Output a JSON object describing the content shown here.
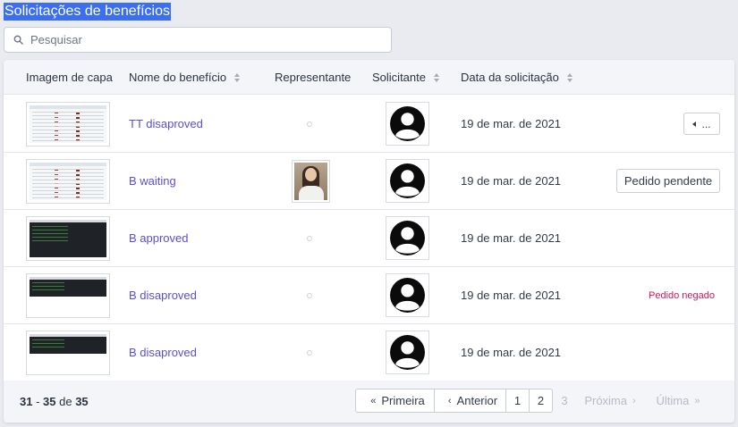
{
  "page_title": "Solicitações de benefícios",
  "search": {
    "placeholder": "Pesquisar",
    "value": ""
  },
  "table": {
    "headers": {
      "cover": "Imagem de capa",
      "benefit": "Nome do benefício",
      "representative": "Representante",
      "requester": "Solicitante",
      "date": "Data da solicitação"
    },
    "rows": [
      {
        "cover_style": "light",
        "benefit": "TT disaproved",
        "has_representative": false,
        "date": "19 de mar. de 2021",
        "action": "more-button",
        "action_label": "..."
      },
      {
        "cover_style": "light",
        "benefit": "B waiting",
        "has_representative": true,
        "date": "19 de mar. de 2021",
        "action": "pending-button",
        "action_label": "Pedido pendente"
      },
      {
        "cover_style": "dark",
        "benefit": "B approved",
        "has_representative": false,
        "date": "19 de mar. de 2021",
        "action": "none",
        "action_label": ""
      },
      {
        "cover_style": "dark-short",
        "benefit": "B disaproved",
        "has_representative": false,
        "date": "19 de mar. de 2021",
        "action": "denied-text",
        "action_label": "Pedido negado"
      },
      {
        "cover_style": "dark-short",
        "benefit": "B disaproved",
        "has_representative": false,
        "date": "19 de mar. de 2021",
        "action": "none",
        "action_label": ""
      }
    ]
  },
  "footer": {
    "range_start": "31",
    "range_sep": " - ",
    "range_end": "35",
    "of_label": " de ",
    "total": "35"
  },
  "pagination": {
    "first": "Primeira",
    "prev": "Anterior",
    "pages": [
      "1",
      "2",
      "3"
    ],
    "next": "Próxima",
    "last": "Última"
  },
  "colors": {
    "link": "#5a4fcf",
    "denied": "#d0185c",
    "title_highlight": "#3b6ff0"
  },
  "icons": [
    "search-icon",
    "sort-icon",
    "user-silhouette-icon",
    "caret-left-icon",
    "double-chevron-left-icon",
    "chevron-left-icon",
    "chevron-right-icon",
    "double-chevron-right-icon"
  ]
}
